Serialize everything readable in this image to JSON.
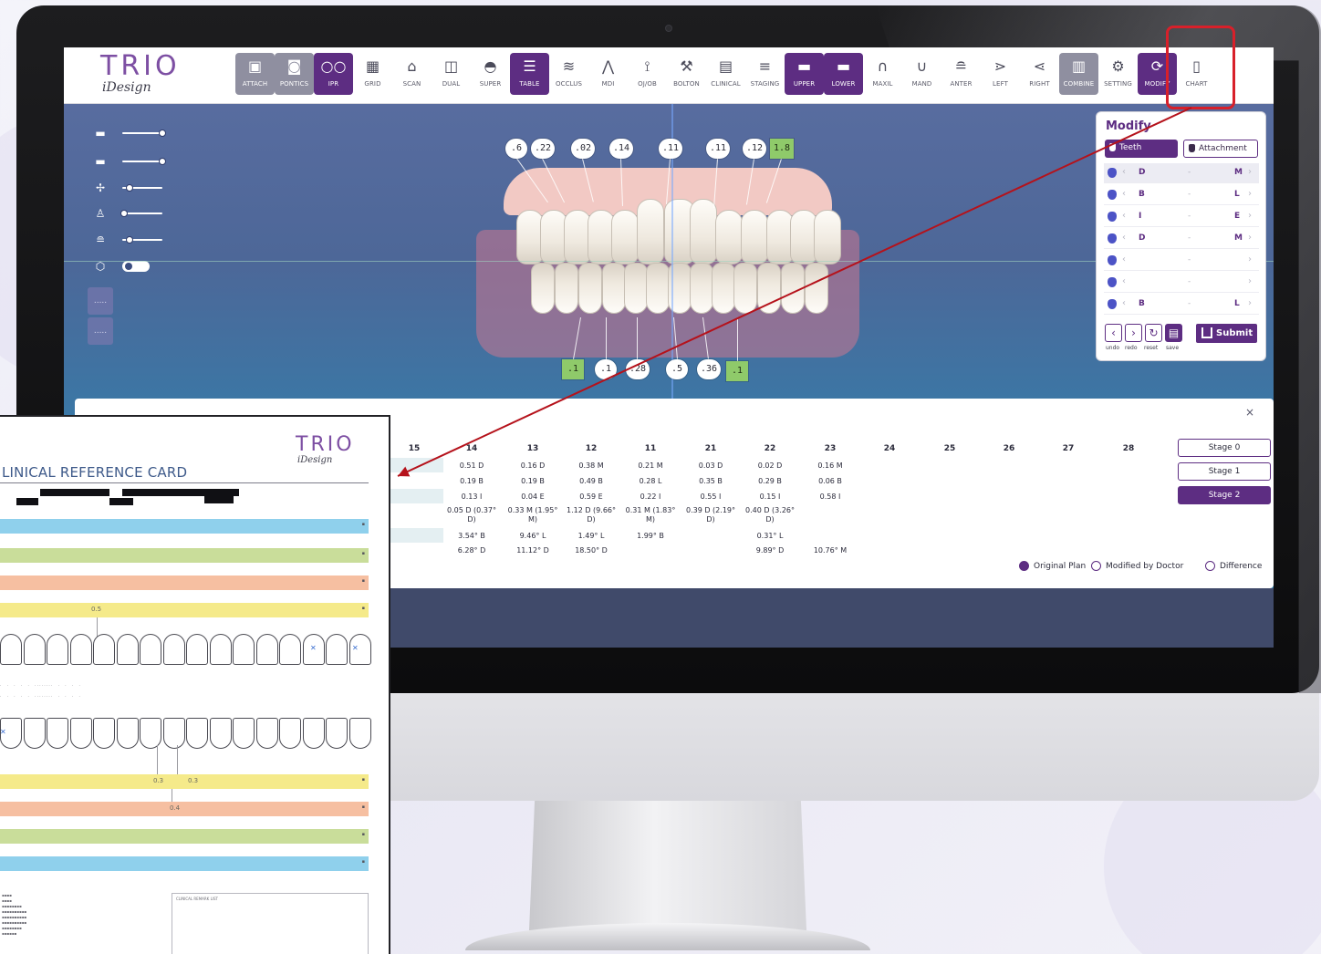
{
  "app": {
    "logo_mark": "TRIO",
    "logo_sub": "iDesign"
  },
  "toolbar": {
    "tools": [
      {
        "label": "ATTACH",
        "icon": "attach-icon",
        "state": "soft"
      },
      {
        "label": "PONTICS",
        "icon": "pontics-icon",
        "state": "soft"
      },
      {
        "label": "IPR",
        "icon": "ipr-icon",
        "state": "active"
      },
      {
        "label": "GRID",
        "icon": "grid-icon",
        "state": "normal"
      },
      {
        "label": "SCAN",
        "icon": "scan-icon",
        "state": "normal"
      },
      {
        "label": "DUAL",
        "icon": "dual-icon",
        "state": "normal"
      },
      {
        "label": "SUPER",
        "icon": "super-icon",
        "state": "normal"
      },
      {
        "label": "TABLE",
        "icon": "table-icon",
        "state": "active"
      },
      {
        "label": "OCCLUS",
        "icon": "occlusion-icon",
        "state": "normal"
      },
      {
        "label": "MDI",
        "icon": "mdi-icon",
        "state": "normal"
      },
      {
        "label": "OJ/OB",
        "icon": "ojob-icon",
        "state": "normal"
      },
      {
        "label": "BOLTON",
        "icon": "bolton-icon",
        "state": "normal"
      },
      {
        "label": "CLINICAL",
        "icon": "clinical-icon",
        "state": "normal"
      },
      {
        "label": "STAGING",
        "icon": "staging-icon",
        "state": "normal"
      },
      {
        "label": "UPPER",
        "icon": "upper-jaw-icon",
        "state": "active"
      },
      {
        "label": "LOWER",
        "icon": "lower-jaw-icon",
        "state": "active"
      },
      {
        "label": "MAXIL",
        "icon": "maxillary-icon",
        "state": "normal"
      },
      {
        "label": "MAND",
        "icon": "mandibular-icon",
        "state": "normal"
      },
      {
        "label": "ANTER",
        "icon": "anterior-icon",
        "state": "normal"
      },
      {
        "label": "LEFT",
        "icon": "left-view-icon",
        "state": "normal"
      },
      {
        "label": "RIGHT",
        "icon": "right-view-icon",
        "state": "normal"
      },
      {
        "label": "COMBINE",
        "icon": "combine-icon",
        "state": "soft"
      },
      {
        "label": "SETTING",
        "icon": "settings-gear-icon",
        "state": "normal"
      },
      {
        "label": "MODIFY",
        "icon": "modify-refresh-icon",
        "state": "active"
      },
      {
        "label": "CHART",
        "icon": "chart-tooth-icon",
        "state": "normal"
      }
    ]
  },
  "left_panel": {
    "sliders": [
      {
        "icon": "upper-arch-icon",
        "level": 1.0
      },
      {
        "icon": "lower-arch-icon",
        "level": 1.0
      },
      {
        "icon": "axis-icon",
        "level": 0.15
      },
      {
        "icon": "gum-icon",
        "level": 0.0
      },
      {
        "icon": "aligner-icon",
        "level": 0.15
      }
    ],
    "toggle": {
      "icon": "cube-icon",
      "on": true
    },
    "buttons": [
      {
        "icon": "upper-preview-icon",
        "label": "....."
      },
      {
        "icon": "lower-preview-icon",
        "label": "....."
      }
    ]
  },
  "ipr": {
    "upper_badges": [
      {
        "text": ".6",
        "green": false
      },
      {
        "text": ".22",
        "green": false
      },
      {
        "text": ".02",
        "green": false
      },
      {
        "text": ".14",
        "green": false
      },
      {
        "text": ".11",
        "green": false
      },
      {
        "text": ".11",
        "green": false
      },
      {
        "text": ".12",
        "green": false
      },
      {
        "text": "1.8",
        "green": true
      }
    ],
    "lower_badges": [
      {
        "text": ".1",
        "green": true
      },
      {
        "text": ".1",
        "green": false
      },
      {
        "text": ".28",
        "green": false
      },
      {
        "text": ".5",
        "green": false
      },
      {
        "text": ".36",
        "green": false
      },
      {
        "text": ".1",
        "green": true
      }
    ]
  },
  "modify_panel": {
    "title": "Modify",
    "tab_teeth": "Teeth",
    "tab_attachment": "Attachment",
    "rows": [
      {
        "left": "D",
        "mid": "-",
        "right": "M",
        "highlight": true
      },
      {
        "left": "B",
        "mid": "-",
        "right": "L",
        "highlight": false
      },
      {
        "left": "I",
        "mid": "-",
        "right": "E",
        "highlight": false
      },
      {
        "left": "D",
        "mid": "-",
        "right": "M",
        "highlight": false
      },
      {
        "left": "",
        "mid": "-",
        "right": "",
        "highlight": false
      },
      {
        "left": "",
        "mid": "-",
        "right": "",
        "highlight": false
      },
      {
        "left": "B",
        "mid": "-",
        "right": "L",
        "highlight": false
      }
    ],
    "undo": "undo",
    "redo": "redo",
    "reset": "reset",
    "save": "save",
    "submit": "Submit"
  },
  "table": {
    "close": "×",
    "columns": [
      "15",
      "14",
      "13",
      "12",
      "11",
      "21",
      "22",
      "23",
      "24",
      "25",
      "26",
      "27",
      "28"
    ],
    "rows": [
      [
        "",
        "0.51 D",
        "0.16 D",
        "0.38 M",
        "0.21 M",
        "0.03 D",
        "0.02 D",
        "0.16 M",
        "",
        "",
        "",
        "",
        ""
      ],
      [
        "",
        "0.19 B",
        "0.19 B",
        "0.49 B",
        "0.28 L",
        "0.35 B",
        "0.29 B",
        "0.06 B",
        "",
        "",
        "",
        "",
        ""
      ],
      [
        "",
        "0.13 I",
        "0.04 E",
        "0.59 E",
        "0.22 I",
        "0.55 I",
        "0.15 I",
        "0.58 I",
        "",
        "",
        "",
        "",
        ""
      ],
      [
        "",
        "0.05 D (0.37° D)",
        "0.33 M (1.95° M)",
        "1.12 D (9.66° D)",
        "0.31 M (1.83° M)",
        "0.39 D (2.19° D)",
        "0.40 D (3.26° D)",
        "",
        "",
        "",
        "",
        "",
        ""
      ],
      [
        "",
        "3.54° B",
        "9.46° L",
        "1.49° L",
        "1.99° B",
        "",
        "0.31° L",
        "",
        "",
        "",
        "",
        "",
        ""
      ],
      [
        "",
        "6.28° D",
        "11.12° D",
        "18.50° D",
        "",
        "",
        "9.89° D",
        "10.76° M",
        "",
        "",
        "",
        "",
        ""
      ]
    ],
    "stages": [
      {
        "label": "Stage 0",
        "active": false
      },
      {
        "label": "Stage 1",
        "active": false
      },
      {
        "label": "Stage 2",
        "active": true
      }
    ],
    "radio": [
      {
        "label": "Original Plan",
        "selected": true
      },
      {
        "label": "Modified by Doctor",
        "selected": false
      },
      {
        "label": "Difference",
        "selected": false
      }
    ]
  },
  "card": {
    "logo_mark": "TRIO",
    "logo_sub": "iDesign",
    "title": "LINICAL REFERENCE CARD",
    "ipr_upper": "0.5",
    "ipr_lower_1": "0.3",
    "ipr_lower_2": "0.3",
    "ipr_lower_3": "0.4",
    "remark_header": "CLINICAL REMARK LIST"
  },
  "colors": {
    "brand_purple": "#5d2d82",
    "highlight_red": "#d8202a",
    "band_blue": "#8fd0ec",
    "band_green": "#c9dd9a",
    "band_orange": "#f6bfa1",
    "band_yellow": "#f5ea8a"
  }
}
